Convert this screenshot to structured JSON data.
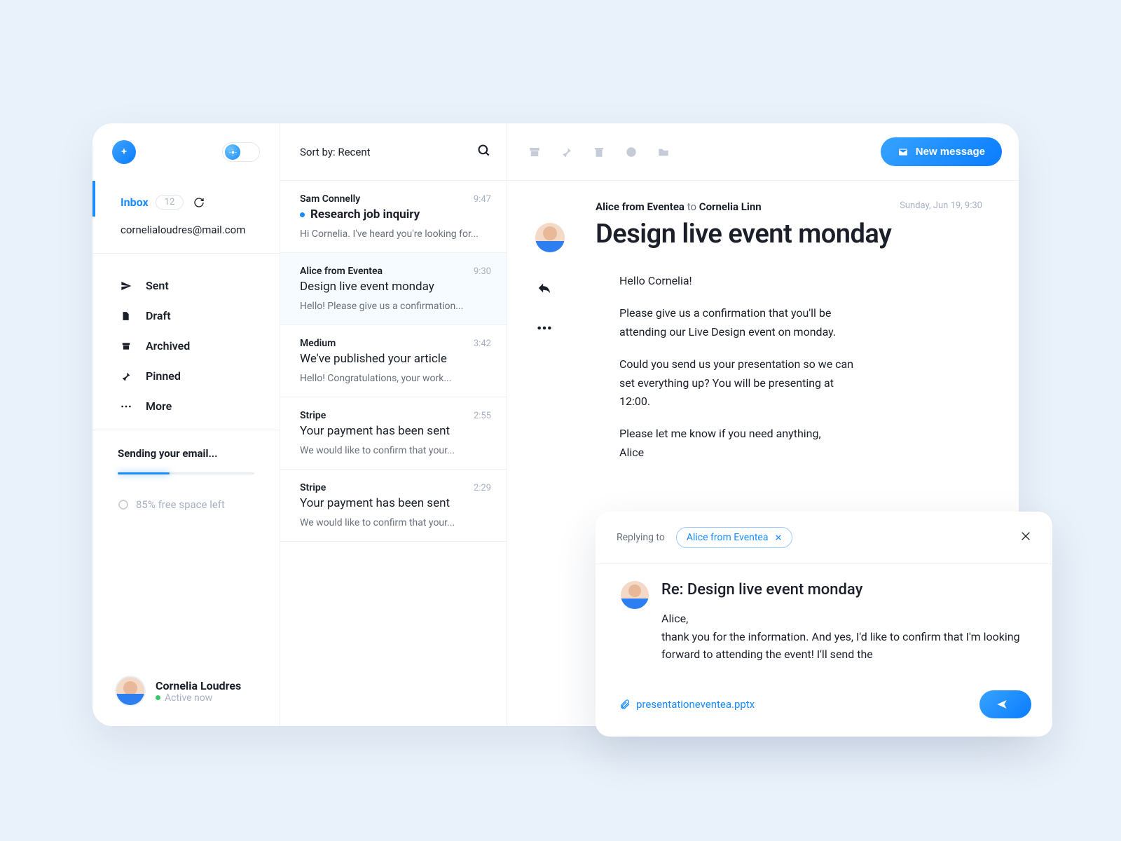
{
  "sidebar": {
    "inbox_label": "Inbox",
    "inbox_count": "12",
    "email": "cornelialoudres@mail.com",
    "nav": [
      {
        "icon": "paper-plane",
        "label": "Sent"
      },
      {
        "icon": "file",
        "label": "Draft"
      },
      {
        "icon": "archive",
        "label": "Archived"
      },
      {
        "icon": "pin",
        "label": "Pinned"
      },
      {
        "icon": "more",
        "label": "More"
      }
    ],
    "sending_label": "Sending your email...",
    "free_space_label": "85% free space left",
    "profile_name": "Cornelia Loudres",
    "profile_status": "Active now"
  },
  "list": {
    "sort_label": "Sort by: Recent",
    "items": [
      {
        "sender": "Sam Connelly",
        "time": "9:47",
        "subject": "Research job inquiry",
        "preview": "Hi Cornelia. I've heard you're looking for...",
        "unread": true,
        "bold": true
      },
      {
        "sender": "Alice from Eventea",
        "time": "9:30",
        "subject": "Design live event monday",
        "preview": "Hello! Please give us a confirmation...",
        "selected": true
      },
      {
        "sender": "Medium",
        "time": "3:42",
        "subject": "We've published your article",
        "preview": "Hello! Congratulations, your work..."
      },
      {
        "sender": "Stripe",
        "time": "2:55",
        "subject": "Your payment has been sent",
        "preview": "We would like to confirm that your..."
      },
      {
        "sender": "Stripe",
        "time": "2:29",
        "subject": "Your payment has been sent",
        "preview": "We would like to confirm that your..."
      }
    ]
  },
  "reader": {
    "new_message_label": "New message",
    "date": "Sunday, Jun 19, 9:30",
    "from_sender": "Alice from Eventea",
    "from_sep": "to",
    "from_recipient": "Cornelia Linn",
    "title": "Design live event monday",
    "body_p1": "Hello Cornelia!",
    "body_p2": "Please give us a confirmation that you'll be attending our Live Design event on monday.",
    "body_p3": "Could you send us your presentation so we can set everything up? You will be presenting at 12:00.",
    "body_p4": "Please let me know if you need anything,",
    "body_p5": "Alice"
  },
  "reply": {
    "replying_to_label": "Replying to",
    "chip_name": "Alice from Eventea",
    "subject": "Re: Design live event monday",
    "body_l1": "Alice,",
    "body_l2": "thank you for the information. And yes, I'd like to confirm that I'm looking forward to attending the event! I'll send the",
    "attachment": "presentationeventea.pptx",
    "send_label": "Send message"
  }
}
